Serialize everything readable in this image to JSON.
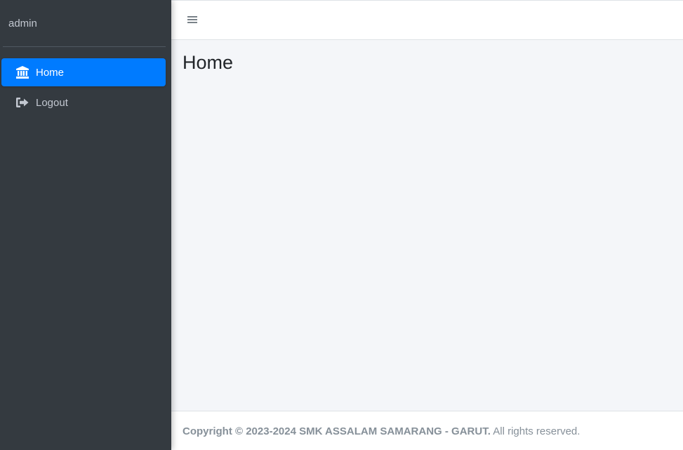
{
  "sidebar": {
    "user": "admin",
    "items": [
      {
        "label": "Home",
        "icon": "bank-icon",
        "active": true
      },
      {
        "label": "Logout",
        "icon": "sign-out-icon",
        "active": false
      }
    ]
  },
  "topbar": {
    "menu_icon": "hamburger-menu-icon"
  },
  "main": {
    "title": "Home"
  },
  "footer": {
    "copyright": "Copyright © 2023-2024 SMK ASSALAM SAMARANG - GARUT.",
    "rights": " All rights reserved."
  },
  "colors": {
    "sidebar_bg": "#343a40",
    "accent": "#007bff",
    "content_bg": "#f4f6f9"
  }
}
